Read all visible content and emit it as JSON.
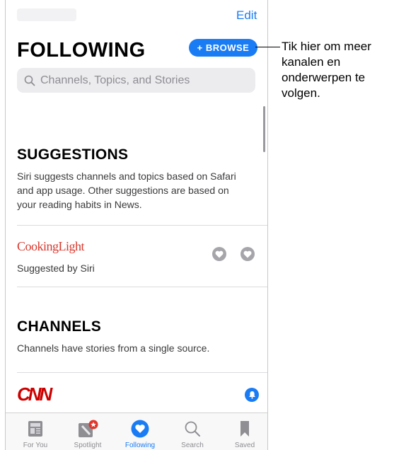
{
  "header": {
    "edit_label": "Edit",
    "title": "FOLLOWING",
    "browse_label": "+ BROWSE"
  },
  "search": {
    "placeholder": "Channels, Topics, and Stories",
    "icon": "search-icon"
  },
  "suggestions": {
    "title": "SUGGESTIONS",
    "description": "Siri suggests channels and topics based on Safari and app usage. Other suggestions are based on your reading habits in News.",
    "item": {
      "logo_text": "CookingLight",
      "subtitle": "Suggested by Siri",
      "actions": [
        "heart-icon",
        "heart-icon"
      ]
    }
  },
  "channels": {
    "title": "CHANNELS",
    "description": "Channels have stories from a single source.",
    "item": {
      "logo_text": "CNN",
      "action_icon": "bell-icon"
    }
  },
  "tabbar": {
    "tabs": [
      {
        "label": "For You",
        "icon": "newspaper-icon",
        "active": false
      },
      {
        "label": "Spotlight",
        "icon": "spotlight-icon",
        "active": false
      },
      {
        "label": "Following",
        "icon": "heart-icon",
        "active": true
      },
      {
        "label": "Search",
        "icon": "search-icon",
        "active": false
      },
      {
        "label": "Saved",
        "icon": "bookmark-icon",
        "active": false
      }
    ]
  },
  "callout": {
    "text": "Tik hier om meer kanalen en onderwerpen te volgen."
  },
  "colors": {
    "accent": "#1a7cf4",
    "cooking_light_red": "#d6392e",
    "cnn_red": "#cc0000",
    "spotlight_badge": "#e0352b"
  }
}
